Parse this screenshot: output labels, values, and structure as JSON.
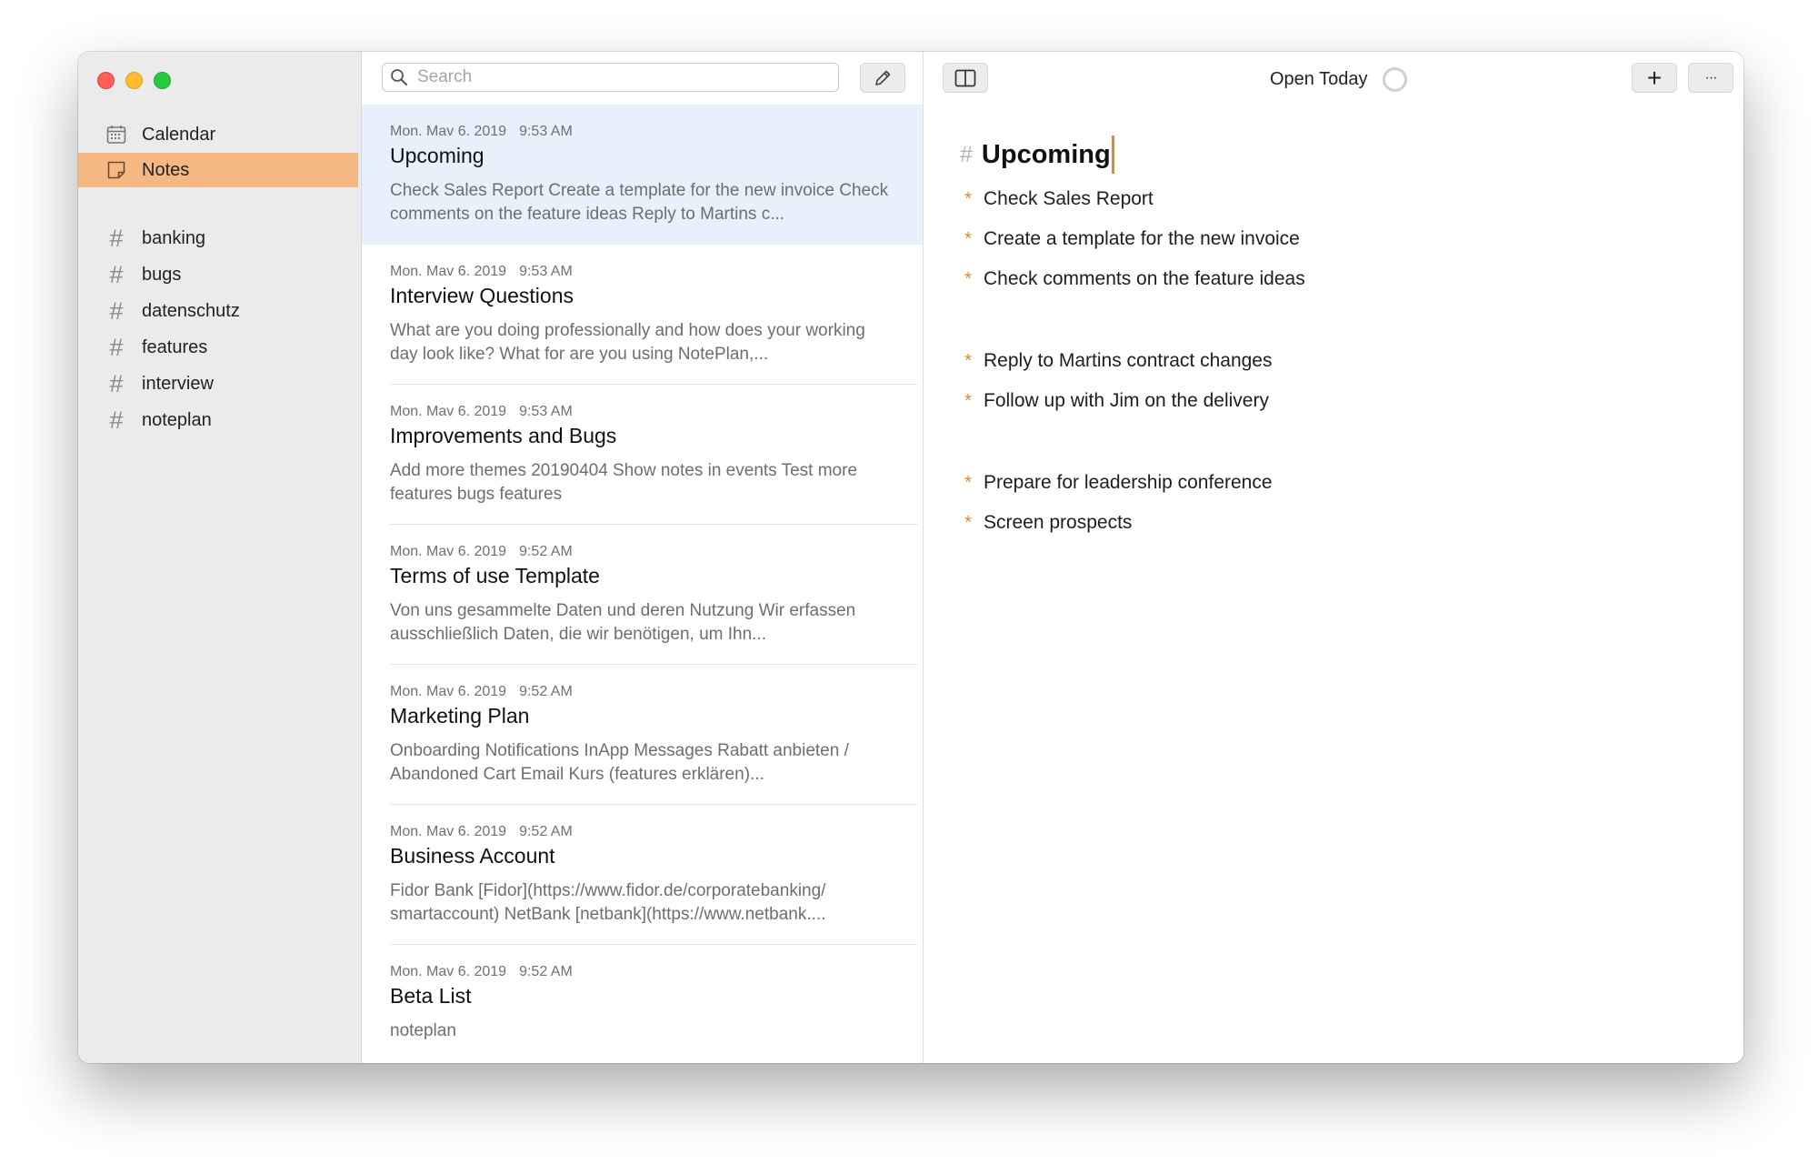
{
  "sidebar": {
    "nav": [
      {
        "label": "Calendar",
        "icon": "calendar-icon",
        "active": false
      },
      {
        "label": "Notes",
        "icon": "note-icon",
        "active": true
      }
    ],
    "tags": [
      "banking",
      "bugs",
      "datenschutz",
      "features",
      "interview",
      "noteplan"
    ],
    "tag_symbol": "#"
  },
  "list": {
    "search_placeholder": "Search",
    "notes": [
      {
        "date": "Mon. Mav 6. 2019",
        "time": "9:53 AM",
        "title": "Upcoming",
        "preview": "Check Sales Report Create a template for the new invoice Check comments on the feature ideas Reply to Martins c...",
        "selected": true
      },
      {
        "date": "Mon. Mav 6. 2019",
        "time": "9:53 AM",
        "title": "Interview Questions",
        "preview": "What are you doing professionally and how does your working day look like? What for are you using NotePlan,...",
        "selected": false
      },
      {
        "date": "Mon. Mav 6. 2019",
        "time": "9:53 AM",
        "title": "Improvements and Bugs",
        "preview": "Add more themes 20190404 Show notes in events Test more features bugs features",
        "selected": false
      },
      {
        "date": "Mon. Mav 6. 2019",
        "time": "9:52 AM",
        "title": "Terms of use Template",
        "preview": "Von uns gesammelte Daten und deren Nutzung Wir erfassen ausschließlich Daten, die wir benötigen, um Ihn...",
        "selected": false
      },
      {
        "date": "Mon. Mav 6. 2019",
        "time": "9:52 AM",
        "title": "Marketing Plan",
        "preview": "Onboarding Notifications InApp Messages Rabatt anbieten / Abandoned Cart Email Kurs (features erklären)...",
        "selected": false
      },
      {
        "date": "Mon. Mav 6. 2019",
        "time": "9:52 AM",
        "title": "Business Account",
        "preview": "Fidor Bank [Fidor](https://www.fidor.de/corporatebanking/ smartaccount) NetBank [netbank](https://www.netbank....",
        "selected": false
      },
      {
        "date": "Mon. Mav 6. 2019",
        "time": "9:52 AM",
        "title": "Beta List",
        "preview": "noteplan",
        "selected": false
      }
    ]
  },
  "editor": {
    "open_today_label": "Open Today",
    "heading_marker": "#",
    "title": "Upcoming",
    "task_marker": "*",
    "tasks": [
      "Check Sales Report",
      "Create a template for the new invoice",
      "Check comments on the feature ideas",
      "Reply to Martins contract changes",
      "Follow up with Jim on the delivery",
      "Prepare for leadership conference",
      "Screen prospects"
    ],
    "add_label": "+",
    "more_label": "···"
  },
  "colors": {
    "accent": "#e8862a",
    "sidebar_active": "#f5b882",
    "selected_note": "#e7f1fb"
  }
}
